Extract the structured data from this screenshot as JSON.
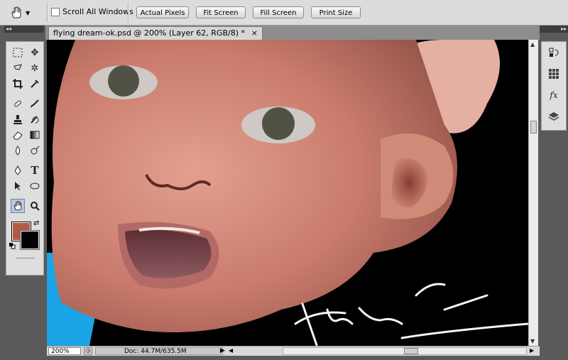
{
  "options_bar": {
    "scroll_all_windows_label": "Scroll All Windows",
    "buttons": {
      "actual_pixels": "Actual Pixels",
      "fit_screen": "Fit Screen",
      "fill_screen": "Fill Screen",
      "print_size": "Print Size"
    }
  },
  "document": {
    "tab_title": "flying dream-ok.psd @ 200% (Layer 62, RGB/8) *",
    "close_glyph": "×"
  },
  "status_bar": {
    "zoom": "200%",
    "doc_info": "Doc: 44.7M/635.5M"
  },
  "colors": {
    "foreground": "#b25a48",
    "background": "#000000"
  },
  "tools": [
    "marquee-icon",
    "move-icon",
    "lasso-icon",
    "magic-wand-icon",
    "crop-icon",
    "eyedropper-icon",
    "healing-brush-icon",
    "brush-icon",
    "clone-stamp-icon",
    "history-brush-icon",
    "eraser-icon",
    "gradient-icon",
    "blur-icon",
    "dodge-icon",
    "pen-icon",
    "type-icon",
    "path-selection-icon",
    "shape-icon",
    "hand-icon",
    "zoom-icon"
  ],
  "right_panel_icons": [
    "history-icon",
    "swatches-icon",
    "styles-icon",
    "layers-icon"
  ]
}
